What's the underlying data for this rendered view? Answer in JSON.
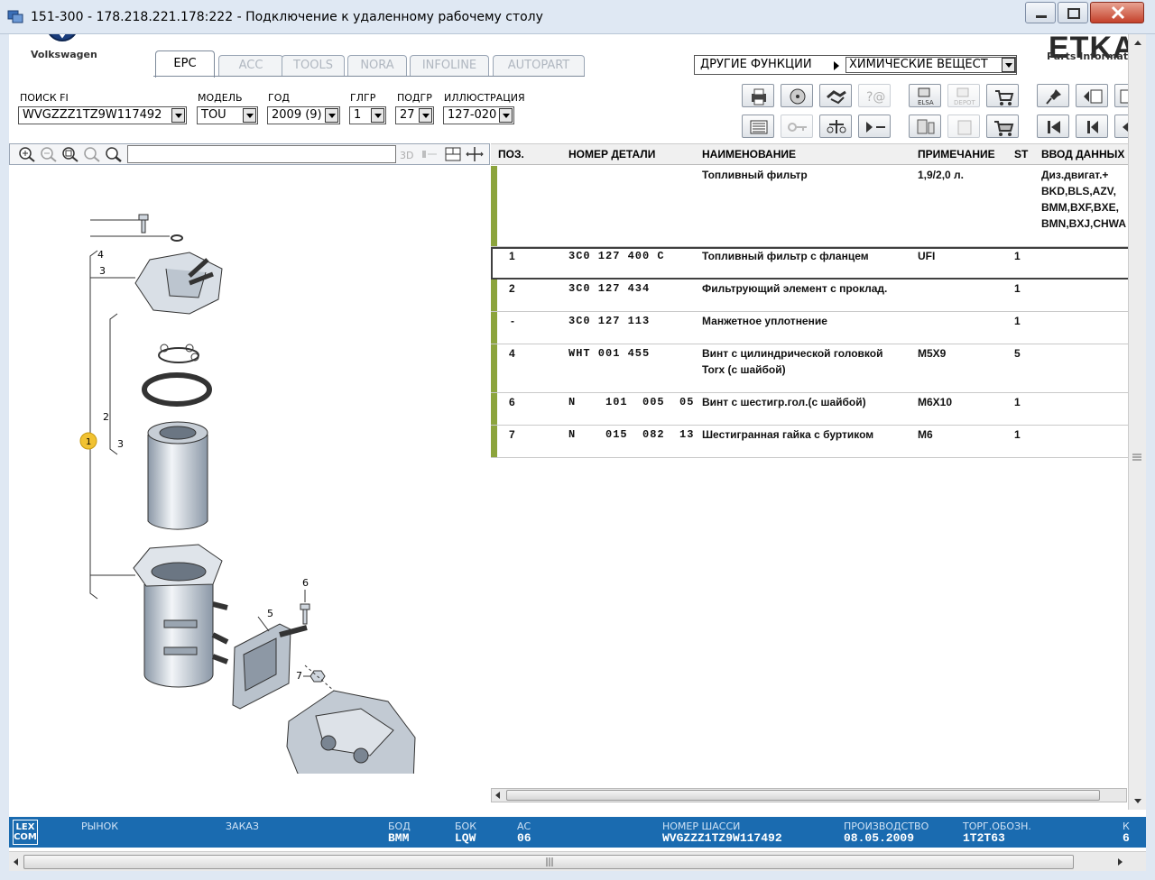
{
  "window": {
    "title": "151-300 - 178.218.221.178:222 - Подключение к удаленному рабочему столу"
  },
  "brand": {
    "vw_label": "Volkswagen",
    "etka_logo": "ETKA",
    "etka_sub": "Parts Informat"
  },
  "tabs": [
    {
      "label": "EPC",
      "active": true
    },
    {
      "label": "ACC",
      "active": false
    },
    {
      "label": "TOOLS",
      "active": false
    },
    {
      "label": "NORA",
      "active": false
    },
    {
      "label": "INFOLINE",
      "active": false
    },
    {
      "label": "AUTOPART",
      "active": false
    }
  ],
  "other_functions": {
    "label": "ДРУГИЕ ФУНКЦИИ",
    "selected": "ХИМИЧЕСКИЕ ВЕЩЕСТ"
  },
  "fields": {
    "search_fi": {
      "label": "ПОИСК FI",
      "value": "WVGZZZ1TZ9W117492"
    },
    "model": {
      "label": "МОДЕЛЬ",
      "value": "TOU"
    },
    "year": {
      "label": "ГОД",
      "value": "2009 (9)"
    },
    "main_group": {
      "label": "ГЛГР",
      "value": "1"
    },
    "sub_group": {
      "label": "ПОДГР",
      "value": "27"
    },
    "illustration": {
      "label": "ИЛЛЮСТРАЦИЯ",
      "value": "127-020"
    }
  },
  "toolbar_icons": {
    "elsa": "ELSA",
    "depot": "DEPOT"
  },
  "table": {
    "headers": {
      "pos": "ПОЗ.",
      "part_number": "НОМЕР ДЕТАЛИ",
      "name": "НАИМЕНОВАНИЕ",
      "note": "ПРИМЕЧАНИЕ",
      "st": "ST",
      "data_entry": "ВВОД ДАННЫХ"
    },
    "rows": [
      {
        "pos": "",
        "part_number": "",
        "name": "Топливный фильтр",
        "note": "1,9/2,0 л.",
        "st": "",
        "data": [
          "Диз.двигат.+",
          "BKD,BLS,AZV,",
          "BMM,BXF,BXE,",
          "BMN,BXJ,CHWA"
        ]
      },
      {
        "pos": "1",
        "part_number": "3C0  127  400  C",
        "name": "Топливный фильтр с фланцем",
        "note": "UFI",
        "st": "1",
        "data": []
      },
      {
        "pos": "2",
        "part_number": "3C0  127  434",
        "name": "Фильтрующий элемент с проклад.",
        "note": "",
        "st": "1",
        "data": []
      },
      {
        "pos": "-",
        "part_number": "3C0  127  113",
        "name": "Манжетное уплотнение",
        "note": "",
        "st": "1",
        "data": []
      },
      {
        "pos": "4",
        "part_number": "WHT  001  455",
        "name": "Винт с цилиндрической головкой",
        "name2": "Torx (с шайбой)",
        "note": "M5X9",
        "st": "5",
        "data": []
      },
      {
        "pos": "6",
        "part_number": "N    101  005  05",
        "name": "Винт с шестигр.гол.(с шайбой)",
        "note": "M6X10",
        "st": "1",
        "data": []
      },
      {
        "pos": "7",
        "part_number": "N    015  082  13",
        "name": "Шестигранная гайка с буртиком",
        "note": "M6",
        "st": "1",
        "data": []
      }
    ]
  },
  "drawing": {
    "callouts": [
      "4",
      "3",
      "2",
      "3",
      "1",
      "6",
      "5",
      "7"
    ],
    "toolbar_3d": "3D"
  },
  "status_bar": {
    "logo": "LEX COM",
    "market_label": "РЫНОК",
    "order_label": "ЗАКАЗ",
    "bod_label": "БОД",
    "bod_value": "BMM",
    "bok_label": "БОК",
    "bok_value": "LQW",
    "ac_label": "АС",
    "ac_value": "06",
    "chassis_label": "НОМЕР ШАССИ",
    "chassis_value": "WVGZZZ1TZ9W117492",
    "production_label": "ПРОИЗВОДСТВО",
    "production_value": "08.05.2009",
    "trade_label": "ТОРГ.ОБОЗН.",
    "trade_value": "1T2T63",
    "extra_label": "К",
    "extra_value": "6"
  },
  "colors": {
    "accent_bar": "#8ca43c",
    "status_bg": "#1a6bb0"
  }
}
